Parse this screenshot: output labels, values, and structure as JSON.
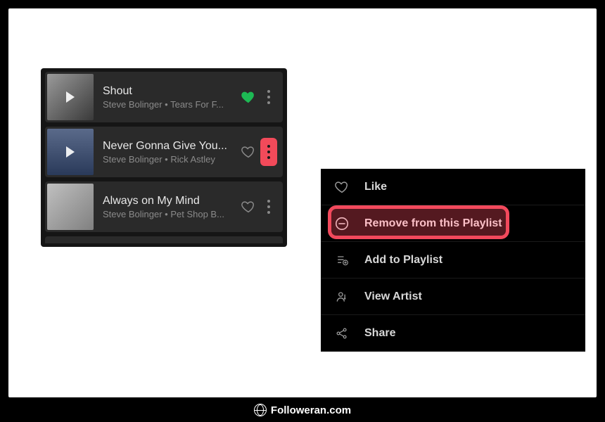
{
  "playlist": {
    "tracks": [
      {
        "title": "Shout",
        "subtitle": "Steve Bolinger • Tears For F...",
        "liked": true,
        "more_highlighted": false
      },
      {
        "title": "Never Gonna Give You...",
        "subtitle": "Steve Bolinger • Rick Astley",
        "liked": false,
        "more_highlighted": true
      },
      {
        "title": "Always on My Mind",
        "subtitle": "Steve Bolinger • Pet Shop B...",
        "liked": false,
        "more_highlighted": false
      }
    ]
  },
  "context_menu": {
    "items": [
      {
        "icon": "heart-outline-icon",
        "label": "Like",
        "highlighted": false
      },
      {
        "icon": "remove-circle-icon",
        "label": "Remove from this Playlist",
        "highlighted": true
      },
      {
        "icon": "playlist-add-icon",
        "label": "Add to Playlist",
        "highlighted": false
      },
      {
        "icon": "view-artist-icon",
        "label": "View Artist",
        "highlighted": false
      },
      {
        "icon": "share-icon",
        "label": "Share",
        "highlighted": false
      }
    ]
  },
  "footer": {
    "label": "Followeran.com"
  },
  "colors": {
    "highlight": "#f2495c",
    "liked_heart": "#1db954"
  }
}
